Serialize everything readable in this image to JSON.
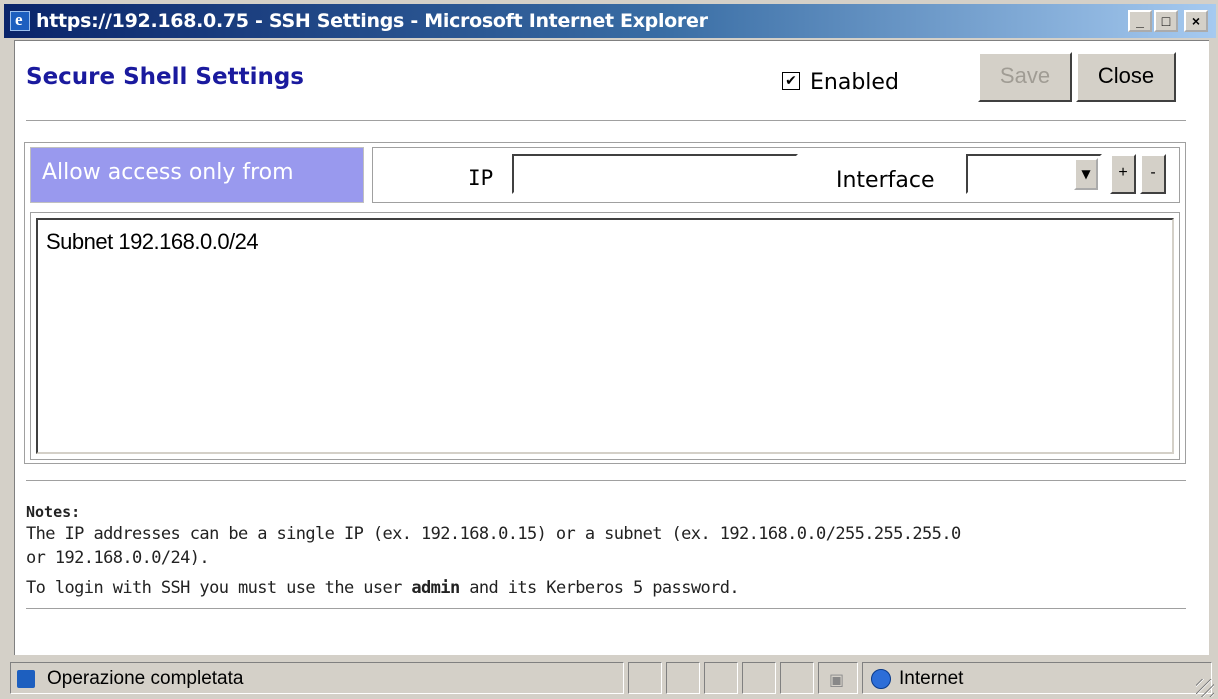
{
  "window": {
    "title": "https://192.168.0.75 - SSH Settings - Microsoft Internet Explorer",
    "controls": {
      "minimize": "_",
      "maximize": "□",
      "close": "×"
    }
  },
  "header": {
    "title": "Secure Shell Settings",
    "enabled_label": "Enabled",
    "enabled_checked": true,
    "checkmark": "✔",
    "save_label": "Save",
    "close_label": "Close"
  },
  "access": {
    "allow_label": "Allow access only from",
    "ip_label": "IP",
    "ip_value": "",
    "interface_label": "Interface",
    "interface_value": "",
    "add_label": "+",
    "remove_label": "-",
    "entries": [
      "Subnet 192.168.0.0/24"
    ]
  },
  "notes": {
    "title": "Notes:",
    "line1": "The IP addresses can be a single IP (ex. 192.168.0.15) or a subnet (ex. 192.168.0.0/255.255.255.0",
    "line2": "or 192.168.0.0/24).",
    "line3_pre": "To login with SSH you must use the user ",
    "line3_bold": "admin",
    "line3_post": " and its Kerberos 5 password."
  },
  "statusbar": {
    "status_text": "Operazione completata",
    "zone_text": "Internet",
    "lock_icon": "lock-icon"
  }
}
